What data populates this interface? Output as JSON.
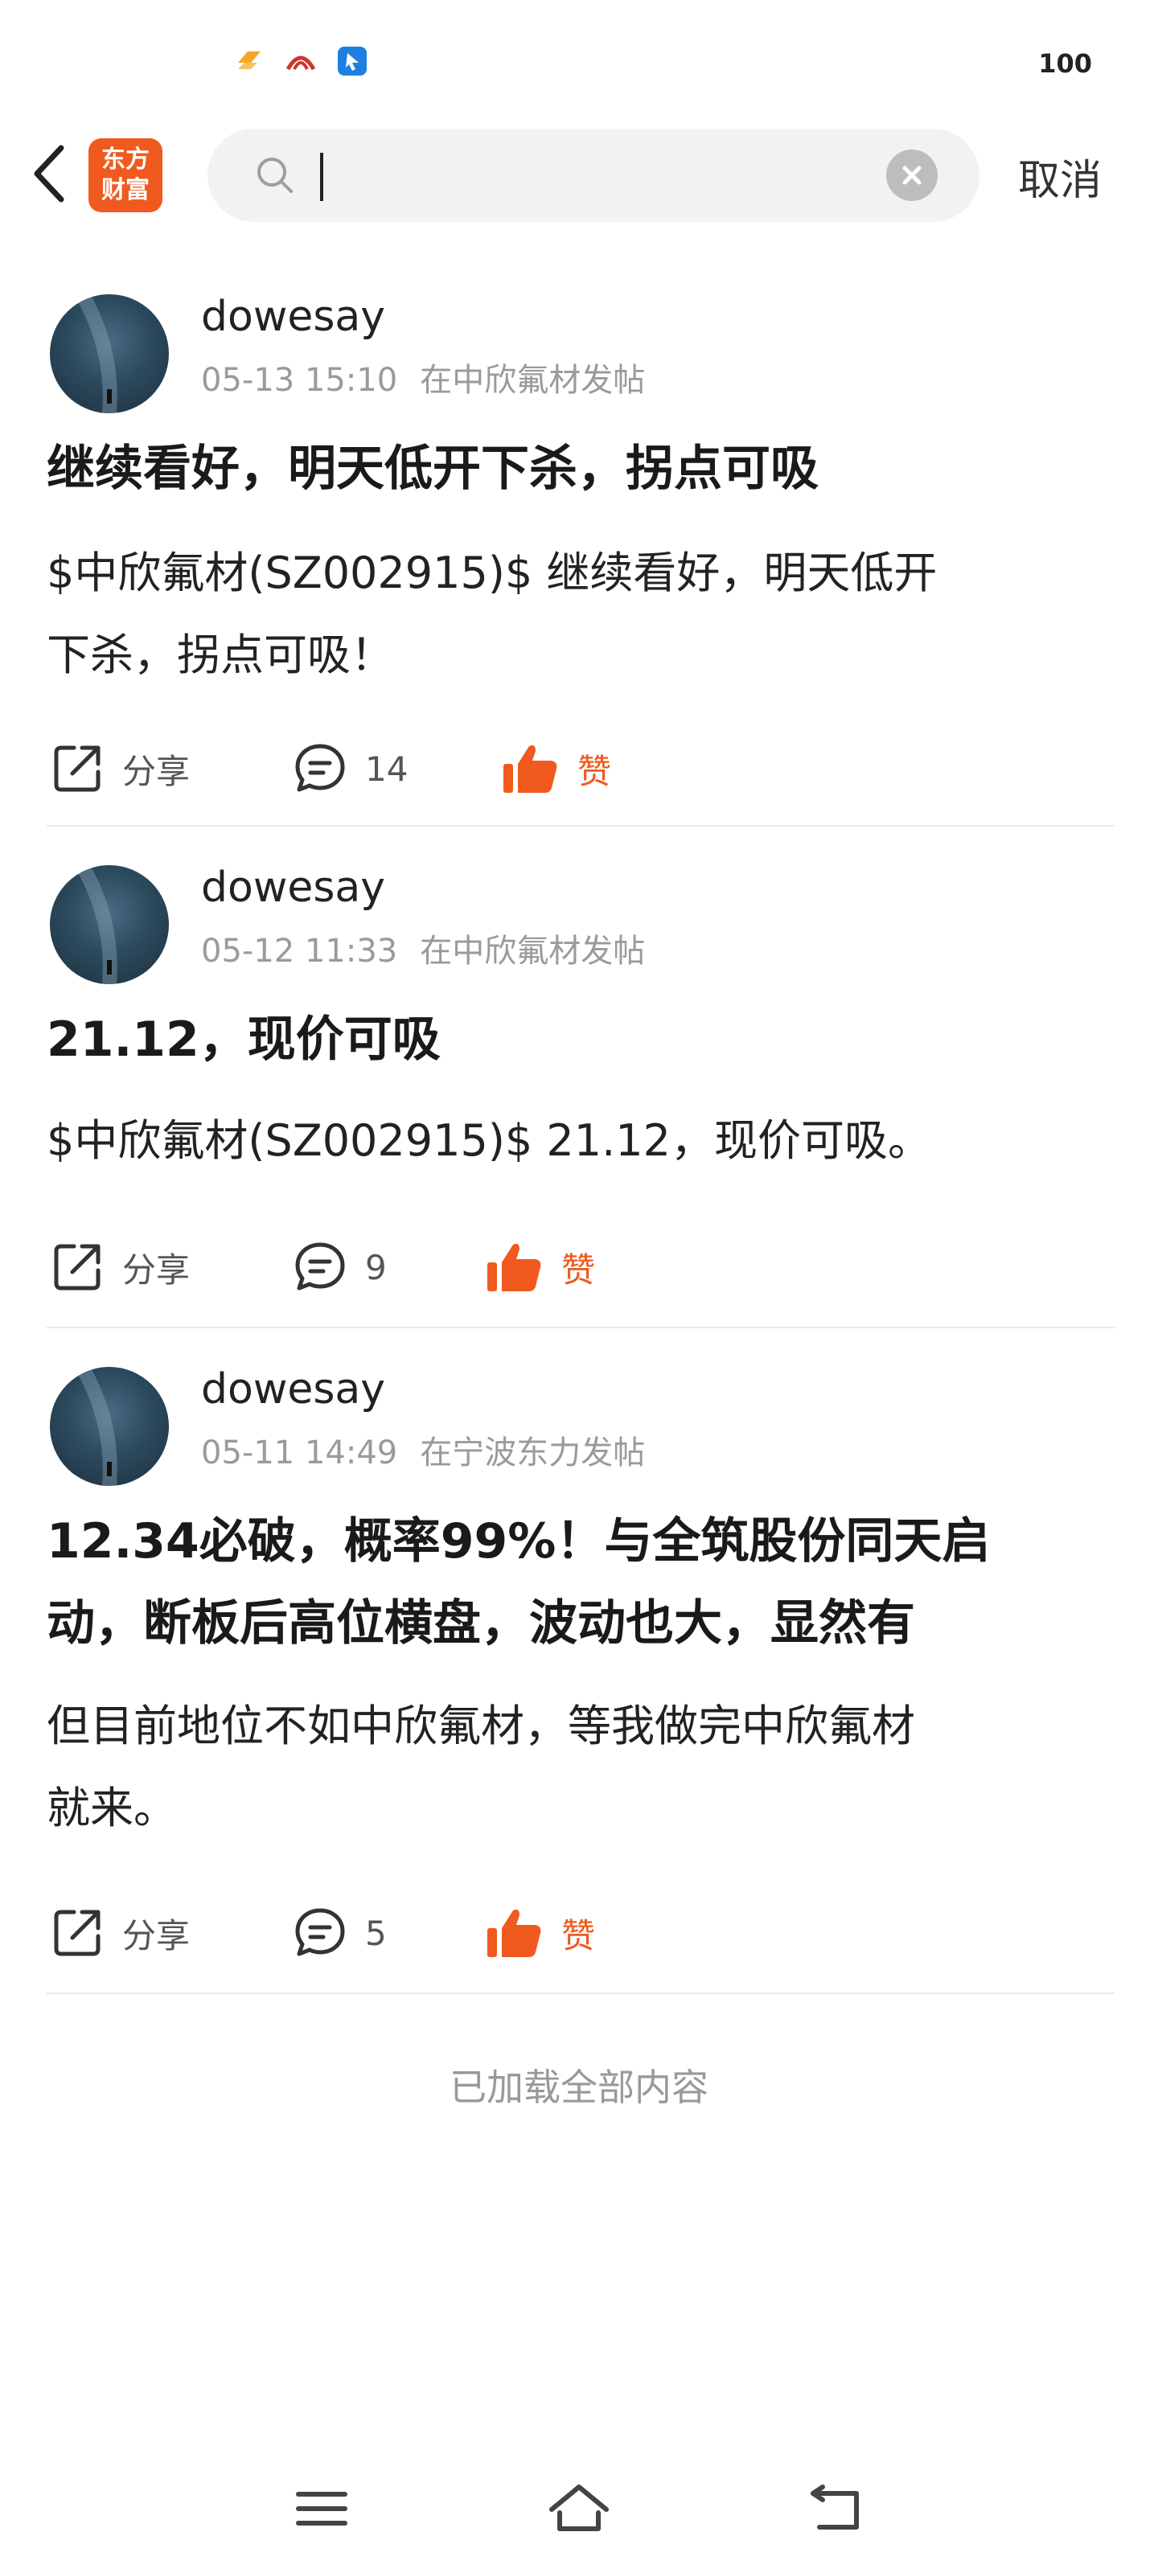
{
  "status_bar": {
    "battery": "100",
    "icons": [
      "app-notify-icon",
      "app-red-icon",
      "app-blue-icon"
    ]
  },
  "header": {
    "logo_line1": "东方",
    "logo_line2": "财富",
    "search_value": "",
    "cancel_label": "取消"
  },
  "colors": {
    "brand": "#f05a1e",
    "meta_gray": "#9a9a9a",
    "search_bg": "#f2f2f2"
  },
  "posts": [
    {
      "username": "dowesay",
      "time": "05-13 15:10",
      "location": "在中欣氟材发帖",
      "title": "继续看好，明天低开下杀，拐点可吸",
      "content_line1": "$中欣氟材(SZ002915)$ 继续看好，明天低开",
      "content_line2": "下杀，拐点可吸！",
      "share_label": "分享",
      "comment_count": "14",
      "like_label": "赞"
    },
    {
      "username": "dowesay",
      "time": "05-12 11:33",
      "location": "在中欣氟材发帖",
      "title": "21.12，现价可吸",
      "content_line1": "$中欣氟材(SZ002915)$ 21.12，现价可吸。",
      "share_label": "分享",
      "comment_count": "9",
      "like_label": "赞"
    },
    {
      "username": "dowesay",
      "time": "05-11 14:49",
      "location": "在宁波东力发帖",
      "title_line1": "12.34必破，概率99%！与全筑股份同天启",
      "title_line2": "动，断板后高位横盘，波动也大，显然有",
      "content_line1": "但目前地位不如中欣氟材，等我做完中欣氟材",
      "content_line2": "就来。",
      "share_label": "分享",
      "comment_count": "5",
      "like_label": "赞"
    }
  ],
  "footer_note": "已加载全部内容"
}
